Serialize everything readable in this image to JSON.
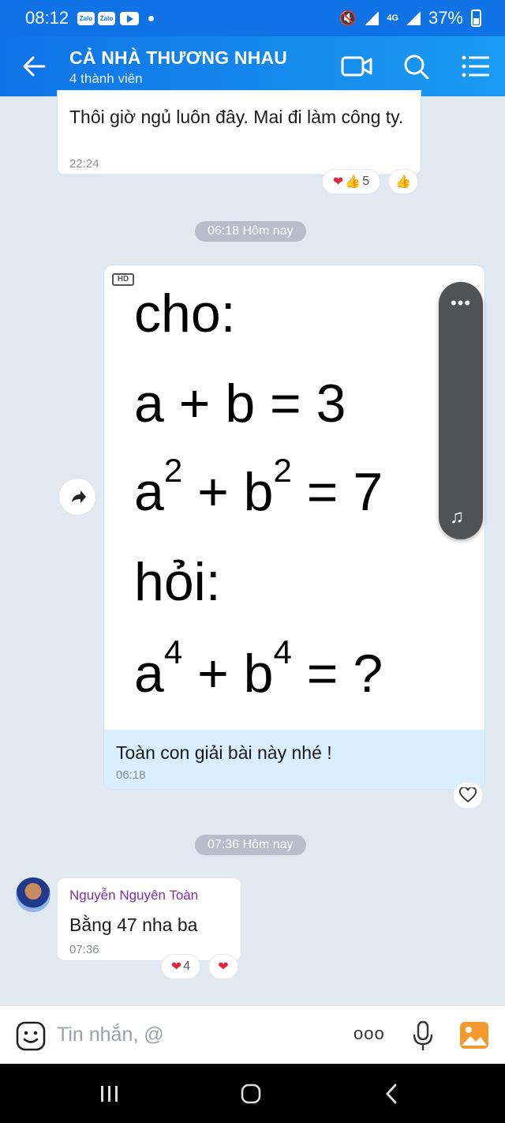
{
  "status_bar": {
    "time": "08:12",
    "zalo1": "Zalo",
    "zalo2": "Zalo",
    "network": "4G",
    "battery": "37%"
  },
  "header": {
    "title": "CẢ NHÀ THƯƠNG NHAU",
    "subtitle": "4 thành viên",
    "icons": [
      "back-arrow-icon",
      "video-call-icon",
      "search-icon",
      "menu-icon"
    ]
  },
  "messages": {
    "m1": {
      "text": "Thôi giờ ngủ luôn đây. Mai đi làm công ty.",
      "time": "22:24",
      "reaction_count": "5"
    },
    "date1": "06:18 Hôm nay",
    "m2": {
      "hd_label": "HD",
      "image_lines": {
        "l1": "cho:",
        "l2": "a + b = 3",
        "l3_a": "a",
        "l3_exp1": "2",
        "l3_mid": " + b",
        "l3_exp2": "2",
        "l3_end": " = 7",
        "l4": "hỏi:",
        "l5_a": "a",
        "l5_exp1": "4",
        "l5_mid": " + b",
        "l5_exp2": "4",
        "l5_end": " = ?"
      },
      "caption": "Toàn con giải bài này nhé !",
      "time": "06:18",
      "float_more": "•••"
    },
    "date2": "07:36 Hôm nay",
    "m3": {
      "sender": "Nguyễn Nguyên Toàn",
      "text": "Bằng 47 nha ba",
      "time": "07:36",
      "reaction_count": "4"
    }
  },
  "input": {
    "placeholder": "Tin nhắn, @",
    "more": "ooo"
  },
  "colors": {
    "header_blue": "#0f73e6",
    "bubble_border": "#c9e3fa",
    "caption_bg": "#d9efff",
    "sender_name": "#7b2fa0"
  }
}
